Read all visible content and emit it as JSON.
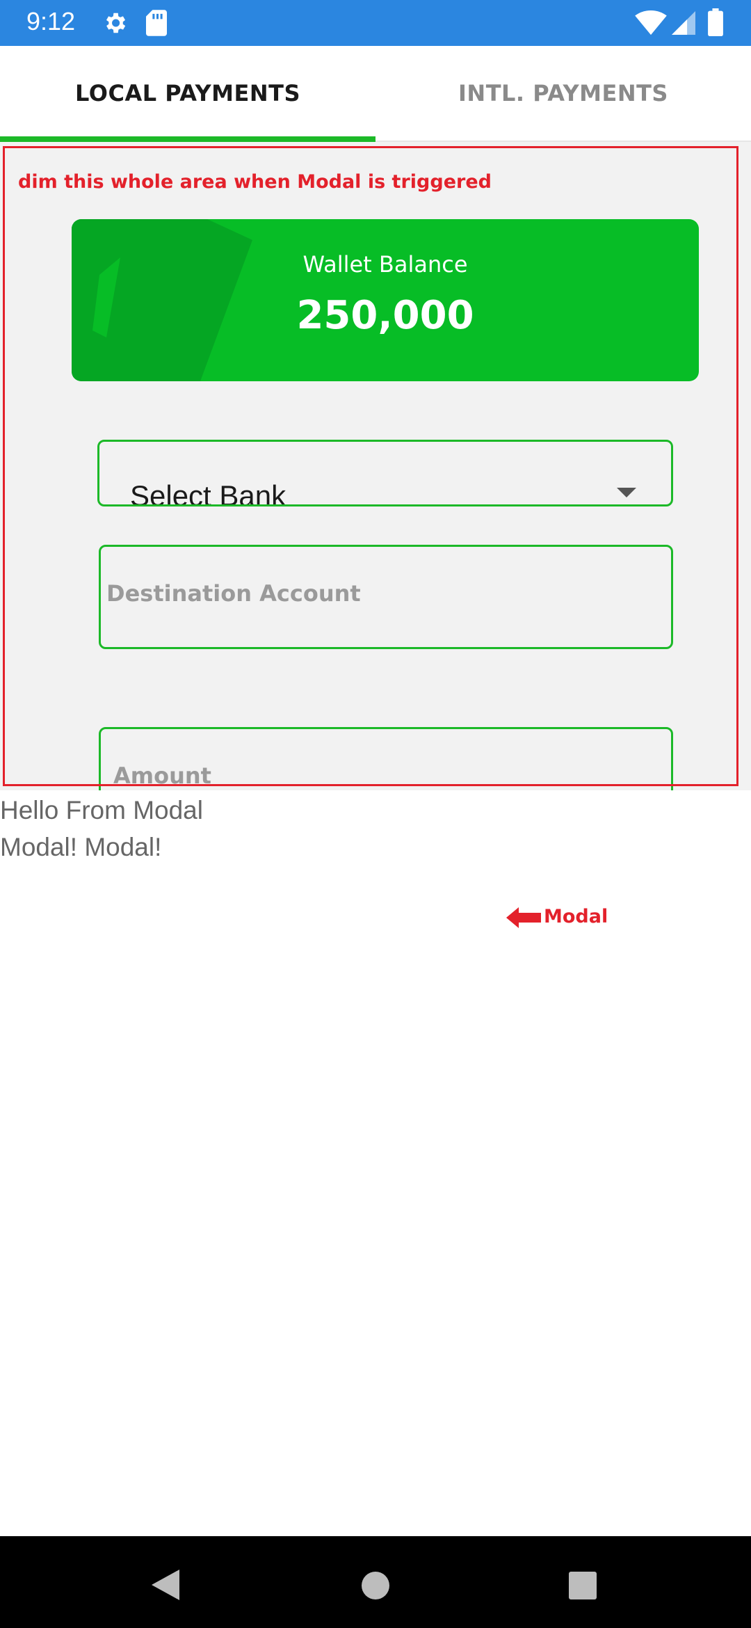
{
  "status_bar": {
    "time": "9:12",
    "icons": [
      "gear-icon",
      "sd-card-icon",
      "wifi-icon",
      "signal-icon",
      "battery-icon"
    ],
    "background": "#2b86e0"
  },
  "tabs": [
    {
      "label": "LOCAL PAYMENTS",
      "active": true
    },
    {
      "label": "INTL. PAYMENTS",
      "active": false
    }
  ],
  "accent_color": "#1cb928",
  "annotation": {
    "dim_note": "dim this whole area when Modal is triggered",
    "modal_note": "Modal",
    "color": "#e3212b"
  },
  "wallet": {
    "label": "Wallet Balance",
    "value": "250,000",
    "background": "#07bd26"
  },
  "form": {
    "select_bank": "Select Bank",
    "destination_placeholder": "Destination Account",
    "amount_placeholder": "Amount"
  },
  "modal": {
    "line1": "Hello From Modal",
    "line2": "Modal! Modal!"
  },
  "nav_bar": {
    "icons": [
      "back-icon",
      "home-icon",
      "recents-icon"
    ]
  }
}
